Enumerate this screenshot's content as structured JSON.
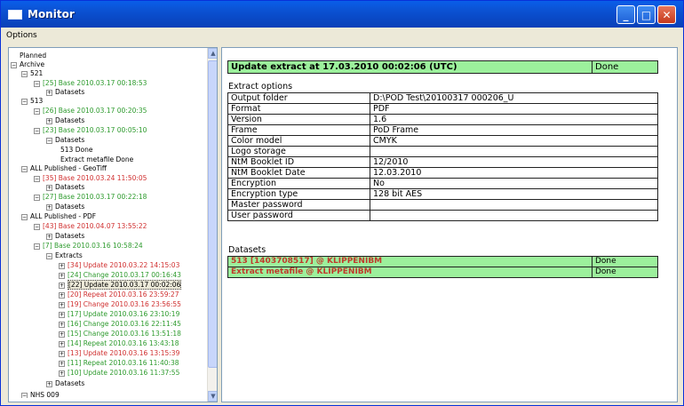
{
  "window": {
    "title": "Monitor"
  },
  "menu": {
    "options": "Options"
  },
  "tree": {
    "planned": "Planned",
    "archive": "Archive",
    "n521": "521",
    "n521_base": "[25] Base 2010.03.17 00:18:53",
    "datasets": "Datasets",
    "n513": "513",
    "n513_base1": "[26] Base 2010.03.17 00:20:35",
    "n513_base2": "[23] Base 2010.03.17 00:05:10",
    "done513": "513 Done",
    "extract_done": "Extract metafile Done",
    "geotiff": "ALL Published - GeoTiff",
    "geotiff_base1": "[35] Base 2010.03.24 11:50:05",
    "geotiff_base2": "[27] Base 2010.03.17 00:22:18",
    "pdf": "ALL Published - PDF",
    "pdf_base1": "[43] Base 2010.04.07 13:55:22",
    "pdf_base2": "[7] Base 2010.03.16 10:58:24",
    "extracts": "Extracts",
    "e34": "[34] Update 2010.03.22 14:15:03",
    "e24": "[24] Change 2010.03.17 00:16:43",
    "e22": "[22] Update 2010.03.17 00:02:06",
    "e20": "[20] Repeat 2010.03.16 23:59:27",
    "e19": "[19] Change 2010.03.16 23:56:55",
    "e17": "[17] Update 2010.03.16 23:10:19",
    "e16": "[16] Change 2010.03.16 22:11:45",
    "e15": "[15] Change 2010.03.16 13:51:18",
    "e14": "[14] Repeat 2010.03.16 13:43:18",
    "e13": "[13] Update 2010.03.16 13:15:39",
    "e11": "[11] Repeat 2010.03.16 11:40:38",
    "e10": "[10] Update 2010.03.16 11:37:55",
    "nhs": "NHS 009"
  },
  "detail": {
    "header": "Update extract at 17.03.2010 00:02:06 (UTC)",
    "header_status": "Done",
    "options_label": "Extract options",
    "options": [
      [
        "Output folder",
        "D:\\POD Test\\20100317 000206_U"
      ],
      [
        "Format",
        "PDF"
      ],
      [
        "Version",
        "1.6"
      ],
      [
        "Frame",
        "PoD Frame"
      ],
      [
        "Color model",
        "CMYK"
      ],
      [
        "Logo storage",
        ""
      ],
      [
        "NtM Booklet ID",
        "12/2010"
      ],
      [
        "NtM Booklet Date",
        "12.03.2010"
      ],
      [
        "Encryption",
        "No"
      ],
      [
        "Encryption type",
        "128 bit AES"
      ],
      [
        "Master password",
        ""
      ],
      [
        "User password",
        ""
      ]
    ],
    "datasets_label": "Datasets",
    "datasets": [
      [
        "513 [1403708517] @ KLIPPENIBM",
        "Done"
      ],
      [
        "Extract metafile @ KLIPPENIBM",
        "Done"
      ]
    ]
  }
}
